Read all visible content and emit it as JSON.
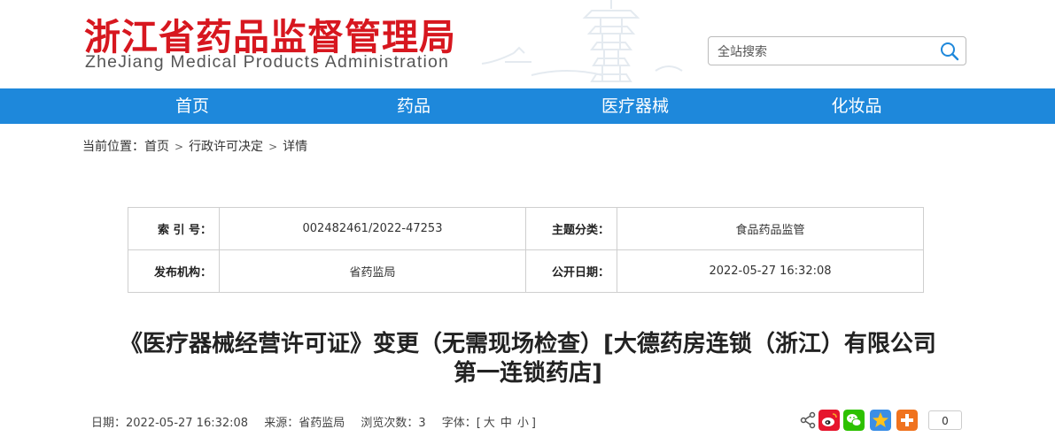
{
  "header": {
    "logo_cn": "浙江省药品监督管理局",
    "logo_en": "ZheJiang Medical Products Administration",
    "search_placeholder": "全站搜索"
  },
  "nav": {
    "items": [
      "首页",
      "药品",
      "医疗器械",
      "化妆品"
    ]
  },
  "breadcrumb": {
    "prefix": "当前位置：",
    "items": [
      "首页",
      "行政许可决定",
      "详情"
    ],
    "separator": ">"
  },
  "info": {
    "index_label": "索 引 号：",
    "index_value": "002482461/2022-47253",
    "topic_label": "主题分类：",
    "topic_value": "食品药品监管",
    "org_label": "发布机构：",
    "org_value": "省药监局",
    "date_label": "公开日期：",
    "date_value": "2022-05-27 16:32:08"
  },
  "article": {
    "title_line1": "《医疗器械经营许可证》变更（无需现场检查）[大德药房连锁（浙江）有限公司",
    "title_line2": "第一连锁药店]"
  },
  "meta": {
    "date": "日期：2022-05-27 16:32:08",
    "source": "来源：省药监局",
    "views": "浏览次数：3",
    "font_label": "字体：[",
    "font_large": "大",
    "font_medium": "中",
    "font_small": "小",
    "font_end": "]"
  },
  "share": {
    "icons": [
      "share-icon",
      "weibo-icon",
      "wechat-icon",
      "qzone-icon",
      "more-share-icon"
    ],
    "count": "0"
  },
  "colors": {
    "brand_red": "#d7171f",
    "nav_blue": "#1e88db"
  }
}
